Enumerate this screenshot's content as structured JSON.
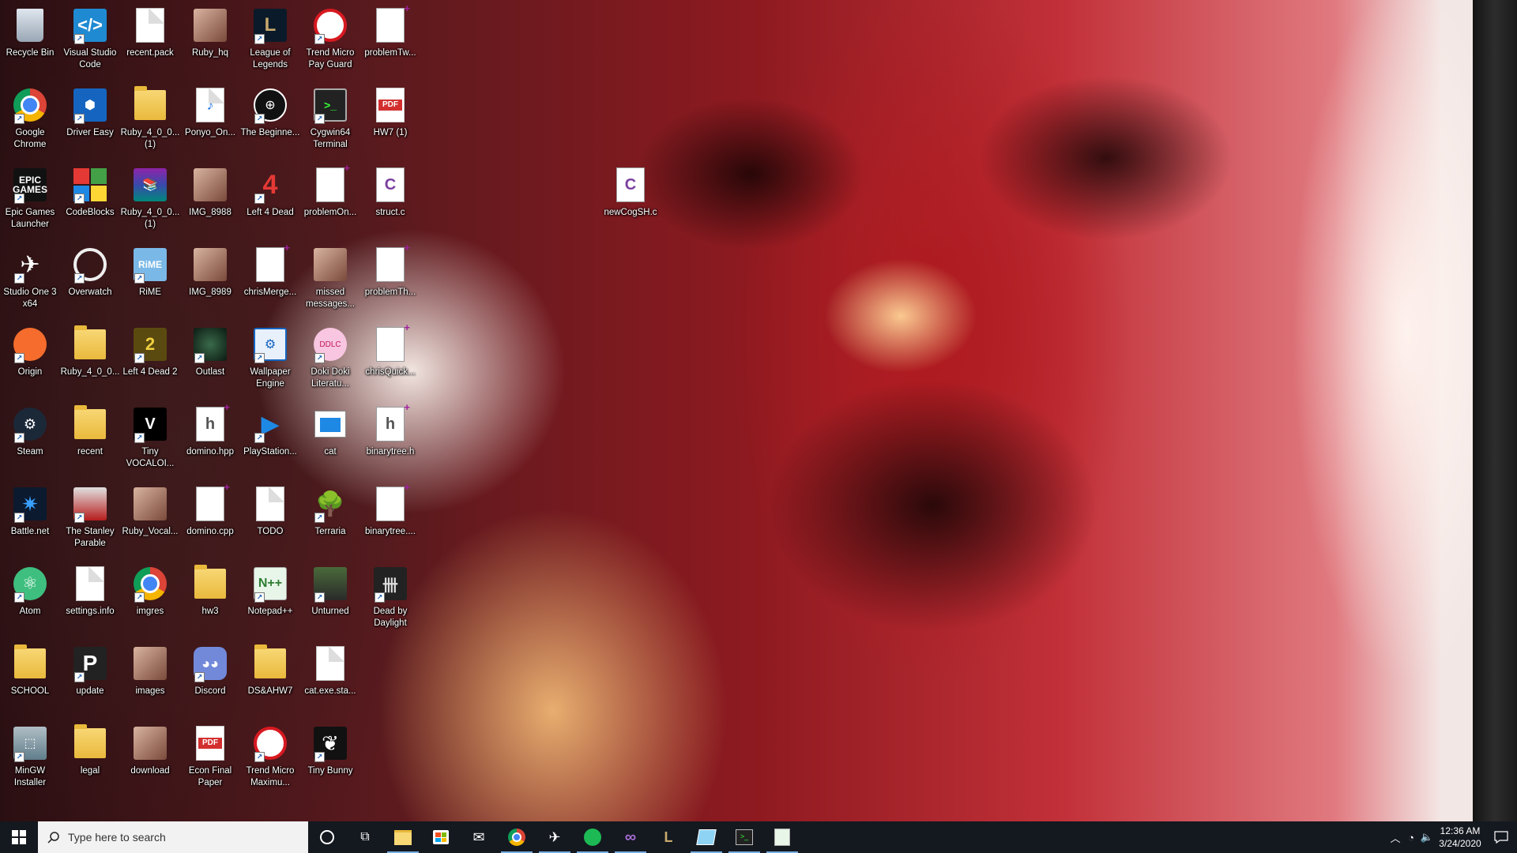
{
  "desktop": {
    "icons": [
      {
        "label": "Recycle Bin",
        "icon": "recycle-bin-icon"
      },
      {
        "label": "Visual Studio Code",
        "icon": "vscode-icon"
      },
      {
        "label": "recent.pack",
        "icon": "file-icon"
      },
      {
        "label": "Ruby_hq",
        "icon": "image-icon"
      },
      {
        "label": "League of Legends",
        "icon": "league-icon"
      },
      {
        "label": "Trend Micro Pay Guard",
        "icon": "trend-micro-icon"
      },
      {
        "label": "problemTw...",
        "icon": "new-file-icon"
      },
      {
        "label": "Google Chrome",
        "icon": "chrome-icon"
      },
      {
        "label": "Driver Easy",
        "icon": "driver-easy-icon"
      },
      {
        "label": "Ruby_4_0_0... (1)",
        "icon": "folder-icon"
      },
      {
        "label": "Ponyo_On...",
        "icon": "audio-file-icon"
      },
      {
        "label": "The Beginne...",
        "icon": "beginners-guide-icon"
      },
      {
        "label": "Cygwin64 Terminal",
        "icon": "terminal-icon"
      },
      {
        "label": "HW7 (1)",
        "icon": "pdf-icon"
      },
      {
        "label": "Epic Games Launcher",
        "icon": "epic-games-icon"
      },
      {
        "label": "CodeBlocks",
        "icon": "codeblocks-icon"
      },
      {
        "label": "Ruby_4_0_0... (1)",
        "icon": "winrar-icon"
      },
      {
        "label": "IMG_8988",
        "icon": "image-icon"
      },
      {
        "label": "Left 4 Dead",
        "icon": "left4dead-icon"
      },
      {
        "label": "problemOn...",
        "icon": "new-file-icon"
      },
      {
        "label": "struct.c",
        "icon": "c-file-icon"
      },
      {
        "label": "Studio One 3 x64",
        "icon": "studio-one-icon"
      },
      {
        "label": "Overwatch",
        "icon": "overwatch-icon"
      },
      {
        "label": "RiME",
        "icon": "rime-icon"
      },
      {
        "label": "IMG_8989",
        "icon": "image-icon"
      },
      {
        "label": "chrisMerge...",
        "icon": "new-file-icon"
      },
      {
        "label": "missed messages...",
        "icon": "image-icon"
      },
      {
        "label": "problemTh...",
        "icon": "new-file-icon"
      },
      {
        "label": "Origin",
        "icon": "origin-icon"
      },
      {
        "label": "Ruby_4_0_0...",
        "icon": "folder-icon"
      },
      {
        "label": "Left 4 Dead 2",
        "icon": "left4dead2-icon"
      },
      {
        "label": "Outlast",
        "icon": "outlast-icon"
      },
      {
        "label": "Wallpaper Engine",
        "icon": "wallpaper-engine-icon"
      },
      {
        "label": "Doki Doki Literatu...",
        "icon": "doki-doki-icon"
      },
      {
        "label": "chrisQuick...",
        "icon": "new-file-icon"
      },
      {
        "label": "Steam",
        "icon": "steam-icon"
      },
      {
        "label": "recent",
        "icon": "folder-icon"
      },
      {
        "label": "Tiny VOCALOI...",
        "icon": "vocaloid-icon"
      },
      {
        "label": "domino.hpp",
        "icon": "header-file-icon"
      },
      {
        "label": "PlayStation...",
        "icon": "playstation-icon"
      },
      {
        "label": "cat",
        "icon": "window-app-icon"
      },
      {
        "label": "binarytree.h",
        "icon": "header-file-icon"
      },
      {
        "label": "Battle.net",
        "icon": "battlenet-icon"
      },
      {
        "label": "The Stanley Parable",
        "icon": "stanley-parable-icon"
      },
      {
        "label": "Ruby_Vocal...",
        "icon": "image-icon"
      },
      {
        "label": "domino.cpp",
        "icon": "new-file-icon"
      },
      {
        "label": "TODO",
        "icon": "text-file-icon"
      },
      {
        "label": "Terraria",
        "icon": "terraria-icon"
      },
      {
        "label": "binarytree....",
        "icon": "new-file-icon"
      },
      {
        "label": "Atom",
        "icon": "atom-icon"
      },
      {
        "label": "settings.info",
        "icon": "file-icon"
      },
      {
        "label": "imgres",
        "icon": "chrome-icon"
      },
      {
        "label": "hw3",
        "icon": "folder-icon"
      },
      {
        "label": "Notepad++",
        "icon": "notepadpp-icon"
      },
      {
        "label": "Unturned",
        "icon": "unturned-icon"
      },
      {
        "label": "Dead by Daylight",
        "icon": "dead-by-daylight-icon"
      },
      {
        "label": "SCHOOL",
        "icon": "folder-icon"
      },
      {
        "label": "update",
        "icon": "update-icon"
      },
      {
        "label": "images",
        "icon": "image-icon"
      },
      {
        "label": "Discord",
        "icon": "discord-icon"
      },
      {
        "label": "DS&AHW7",
        "icon": "folder-icon"
      },
      {
        "label": "cat.exe.sta...",
        "icon": "file-icon"
      },
      {
        "label": "MinGW Installer",
        "icon": "mingw-icon"
      },
      {
        "label": "legal",
        "icon": "folder-icon"
      },
      {
        "label": "download",
        "icon": "image-icon"
      },
      {
        "label": "Econ Final Paper",
        "icon": "pdf-icon"
      },
      {
        "label": "Trend Micro Maximu...",
        "icon": "trend-micro-icon"
      },
      {
        "label": "Tiny Bunny",
        "icon": "tiny-bunny-icon"
      },
      {
        "label": "newCogSH.c",
        "icon": "c-file-icon"
      }
    ]
  },
  "taskbar": {
    "search_placeholder": "Type here to search",
    "pinned": [
      {
        "icon": "cortana-icon"
      },
      {
        "icon": "task-view-icon"
      },
      {
        "icon": "file-explorer-icon"
      },
      {
        "icon": "store-icon"
      },
      {
        "icon": "mail-icon"
      },
      {
        "icon": "chrome-icon"
      },
      {
        "icon": "studio-one-icon"
      },
      {
        "icon": "spotify-icon"
      },
      {
        "icon": "visual-studio-icon"
      },
      {
        "icon": "league-icon"
      },
      {
        "icon": "windows-app-icon"
      },
      {
        "icon": "terminal-icon"
      },
      {
        "icon": "notepadpp-icon"
      }
    ],
    "clock": {
      "time": "12:36 AM",
      "date": "3/24/2020"
    }
  },
  "colors": {
    "taskbar": "#14181f",
    "search_bg": "#f2f2f2",
    "accent": "#7aaee0"
  }
}
